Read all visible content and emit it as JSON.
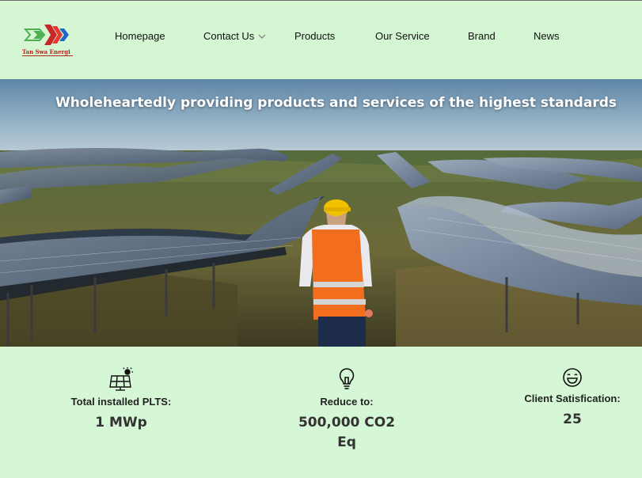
{
  "brand": {
    "name": "Tan Swa Energi"
  },
  "nav": {
    "items": [
      {
        "label": "Homepage"
      },
      {
        "label": "Contact Us",
        "has_dropdown": true
      },
      {
        "label": "Products"
      },
      {
        "label": "Our Service"
      },
      {
        "label": "Brand"
      },
      {
        "label": "News"
      }
    ]
  },
  "hero": {
    "title": "Wholeheartedly providing products and services of the highest standards"
  },
  "stats": [
    {
      "icon": "solar-panel-icon",
      "label": "Total installed PLTS:",
      "value": "1 MWp"
    },
    {
      "icon": "lightbulb-icon",
      "label": "Reduce to:",
      "value_line1": "500,000 CO2",
      "value_line2": "Eq"
    },
    {
      "icon": "smile-icon",
      "label": "Client Satisfication:",
      "value": "25"
    }
  ],
  "colors": {
    "header_bg": "#d4f6d2",
    "page_bg": "#d6f7d6",
    "logo_red": "#b3261e",
    "logo_green": "#4caf50",
    "logo_blue": "#1e66c8"
  }
}
